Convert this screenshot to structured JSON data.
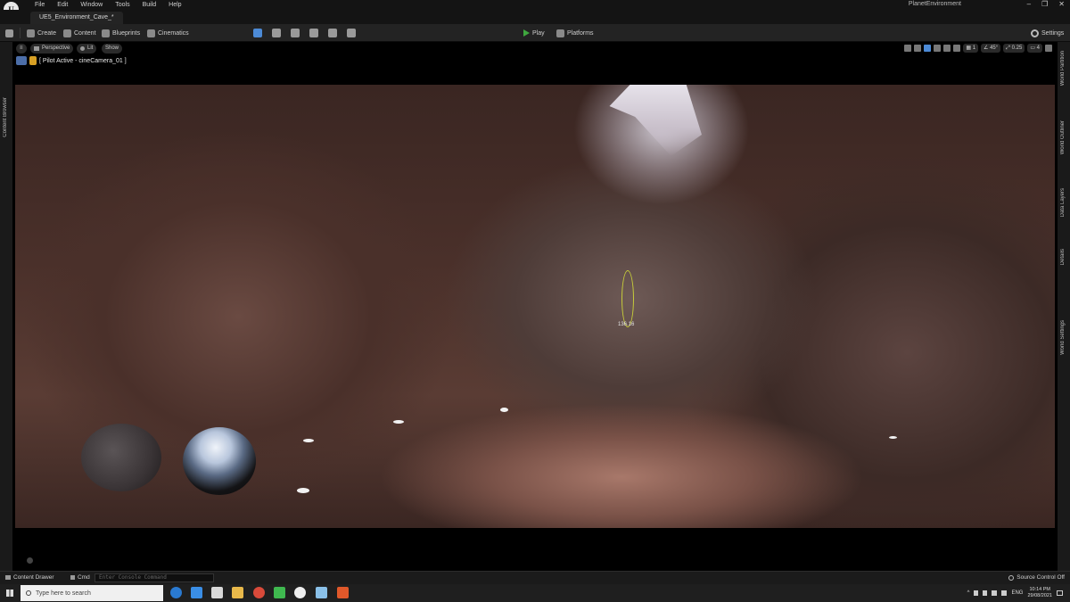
{
  "menubar": {
    "logo": "U",
    "items": [
      "File",
      "Edit",
      "Window",
      "Tools",
      "Build",
      "Help"
    ],
    "project_name": "PlanetEnvironment",
    "window_buttons": [
      "–",
      "❐",
      "✕"
    ]
  },
  "level_tab": {
    "label": "UE5_Environment_Cave_*"
  },
  "toolbar": {
    "create": "Create",
    "content": "Content",
    "blueprints": "Blueprints",
    "cinematics": "Cinematics",
    "play": "Play",
    "platforms": "Platforms",
    "settings": "Settings"
  },
  "left_panel": {
    "content_browser": "Content Browser"
  },
  "right_panel": {
    "world_partition": "World Partition",
    "world_outliner": "World Outliner",
    "data_layers": "Data Layers",
    "details": "Details",
    "world_settings": "World Settings"
  },
  "viewport": {
    "menu_icon": "≡",
    "perspective": "Perspective",
    "lit": "Lit",
    "show": "Show",
    "pilot_text": "[ Pilot Active - cineCamera_01 ]",
    "grid_snap": "1",
    "rotation_snap": "45°",
    "scale_snap": "0.25",
    "camera_speed": "4",
    "distance_label": "136.16"
  },
  "statusbar": {
    "content_drawer": "Content Drawer",
    "cmd": "Cmd",
    "console_placeholder": "Enter Console Command",
    "source_control": "Source Control Off"
  },
  "taskbar": {
    "search_placeholder": "Type here to search",
    "language": "ENG",
    "time": "10:14 PM",
    "date": "29/08/2021"
  },
  "colors": {
    "play_green": "#3fa83f",
    "gizmo_yellow": "#c6cc3a",
    "pilot_blue": "#4c6ea8"
  }
}
